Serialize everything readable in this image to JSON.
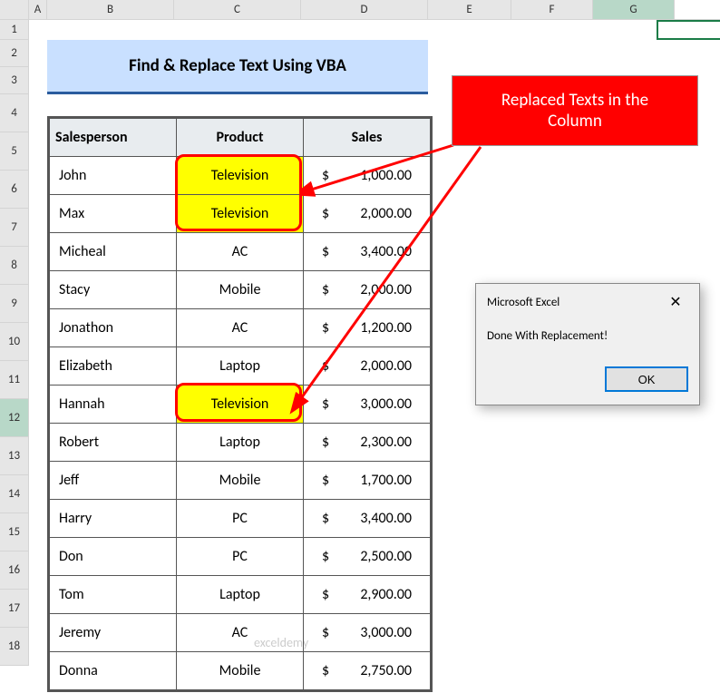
{
  "columns": [
    "A",
    "B",
    "C",
    "D",
    "E",
    "F",
    "G"
  ],
  "rows": [
    "1",
    "2",
    "3",
    "4",
    "5",
    "6",
    "7",
    "8",
    "9",
    "10",
    "11",
    "12",
    "13",
    "14",
    "15",
    "16",
    "17",
    "18"
  ],
  "title": "Find & Replace Text Using VBA",
  "table": {
    "headers": {
      "salesperson": "Salesperson",
      "product": "Product",
      "sales": "Sales"
    },
    "rows": [
      {
        "name": "John",
        "product": "Television",
        "sales": "1,000.00",
        "hl": true
      },
      {
        "name": "Max",
        "product": "Television",
        "sales": "2,000.00",
        "hl": true
      },
      {
        "name": "Micheal",
        "product": "AC",
        "sales": "3,400.00",
        "hl": false
      },
      {
        "name": "Stacy",
        "product": "Mobile",
        "sales": "2,000.00",
        "hl": false
      },
      {
        "name": "Jonathon",
        "product": "AC",
        "sales": "1,200.00",
        "hl": false
      },
      {
        "name": "Elizabeth",
        "product": "Laptop",
        "sales": "2,000.00",
        "hl": false
      },
      {
        "name": "Hannah",
        "product": "Television",
        "sales": "3,000.00",
        "hl": true
      },
      {
        "name": "Robert",
        "product": "Laptop",
        "sales": "2,300.00",
        "hl": false
      },
      {
        "name": "Jeff",
        "product": "Mobile",
        "sales": "1,700.00",
        "hl": false
      },
      {
        "name": "Harry",
        "product": "PC",
        "sales": "3,400.00",
        "hl": false
      },
      {
        "name": "Don",
        "product": "PC",
        "sales": "2,500.00",
        "hl": false
      },
      {
        "name": "Tom",
        "product": "Laptop",
        "sales": "2,900.00",
        "hl": false
      },
      {
        "name": "Jeremy",
        "product": "AC",
        "sales": "3,000.00",
        "hl": false
      },
      {
        "name": "Donna",
        "product": "Mobile",
        "sales": "2,750.00",
        "hl": false
      }
    ],
    "currency": "$"
  },
  "callout": "Replaced Texts in the\nColumn",
  "dialog": {
    "title": "Microsoft Excel",
    "message": "Done With Replacement!",
    "ok": "OK"
  },
  "selected_row": "12",
  "selected_col": "G",
  "watermark": "exceldemy"
}
